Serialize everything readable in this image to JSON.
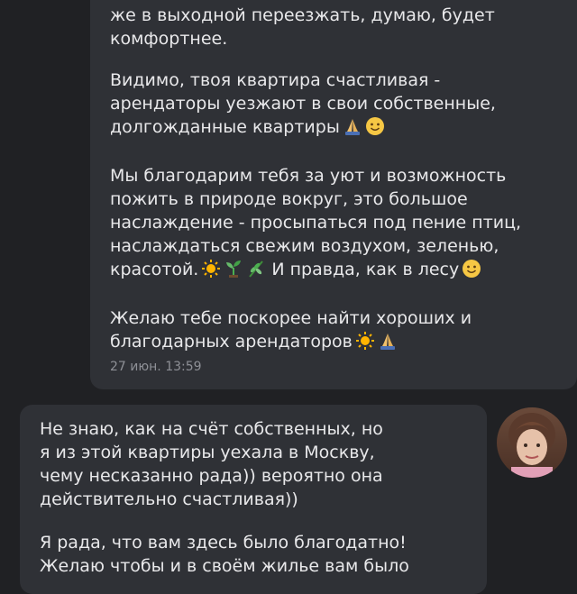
{
  "incoming": {
    "p1": [
      "же в выходной переезжать, думаю, будет",
      "комфортнее."
    ],
    "p2": [
      "Видимо, твоя квартира счастливая -",
      "арендаторы уезжают в свои собственные,",
      "долгожданные квартиры"
    ],
    "p3": [
      "Мы благодарим тебя за уют и возможность",
      "пожить в  природе вокруг, это большое",
      "наслаждение - просыпаться под пение птиц,",
      "наслаждаться  свежим воздухом, зеленью,",
      "красотой.",
      " И правда, как в лесу"
    ],
    "p4": [
      "Желаю тебе поскорее найти хороших и",
      "благодарных арендаторов"
    ],
    "time": "27 июн. 13:59"
  },
  "outgoing": {
    "p1": [
      "Не знаю, как на счёт собственных, но",
      "я из этой квартиры уехала в Москву,",
      "чему несказанно рада)) вероятно она",
      "действительно счастливая))"
    ],
    "p2": [
      "Я рада, что вам здесь было благодатно!",
      "Желаю чтобы и в своём жилье вам было"
    ]
  },
  "icons": {
    "pray": "pray-icon",
    "smile": "smile-icon",
    "sun": "sun-icon",
    "seedling": "seedling-icon",
    "herb": "herb-icon"
  },
  "colors": {
    "background": "#202124",
    "bubble": "#2f3136",
    "text": "#e8e8ea",
    "timestamp": "#8e9096"
  }
}
